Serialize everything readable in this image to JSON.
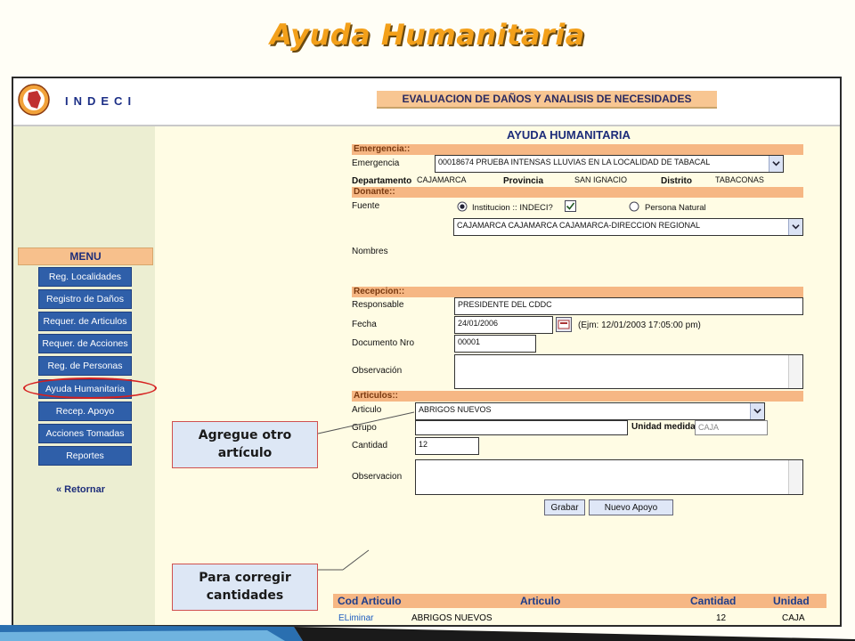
{
  "slide": {
    "title": "Ayuda Humanitaria"
  },
  "header": {
    "brand": "INDECI",
    "banner": "EVALUACION DE DAÑOS Y ANALISIS DE NECESIDADES"
  },
  "sidebar": {
    "menu_title": "MENU",
    "items": [
      {
        "label": "Reg. Localidades"
      },
      {
        "label": "Registro de Daños"
      },
      {
        "label": "Requer. de Articulos"
      },
      {
        "label": "Requer. de Acciones"
      },
      {
        "label": "Reg. de Personas"
      },
      {
        "label": "Ayuda Humanitaria"
      },
      {
        "label": "Recep. Apoyo"
      },
      {
        "label": "Acciones Tomadas"
      },
      {
        "label": "Reportes"
      }
    ],
    "back": "« Retornar"
  },
  "form": {
    "page_title": "AYUDA HUMANITARIA",
    "emergencia": {
      "section": "Emergencia::",
      "label": "Emergencia",
      "value": "00018674 PRUEBA INTENSAS LLUVIAS EN LA LOCALIDAD DE TABACAL",
      "departamento_label": "Departamento",
      "departamento": "CAJAMARCA",
      "provincia_label": "Provincia",
      "provincia": "SAN IGNACIO",
      "distrito_label": "Distrito",
      "distrito": "TABACONAS"
    },
    "donante": {
      "section": "Donante::",
      "fuente_label": "Fuente",
      "opt_institucion": "Institucion :: INDECI?",
      "opt_persona": "Persona Natural",
      "institucion_value": "CAJAMARCA CAJAMARCA CAJAMARCA-DIRECCION REGIONAL",
      "nombres_label": "Nombres"
    },
    "recepcion": {
      "section": "Recepcion::",
      "responsable_label": "Responsable",
      "responsable": "PRESIDENTE DEL CDDC",
      "fecha_label": "Fecha",
      "fecha": "24/01/2006",
      "fecha_hint": "(Ejm: 12/01/2003 17:05:00 pm)",
      "documento_label": "Documento Nro",
      "documento": "00001",
      "observacion_label": "Observación",
      "observacion": ""
    },
    "articulos": {
      "section": "Articulos::",
      "articulo_label": "Articulo",
      "articulo": "ABRIGOS NUEVOS",
      "grupo_label": "Grupo",
      "grupo": "",
      "unidad_label": "Unidad medida",
      "unidad": "CAJA",
      "cantidad_label": "Cantidad",
      "cantidad": "12",
      "observacion_label": "Observacion",
      "observacion": ""
    },
    "buttons": {
      "grabar": "Grabar",
      "nuevo": "Nuevo Apoyo"
    }
  },
  "table": {
    "headers": [
      "Cod Articulo",
      "Articulo",
      "Cantidad",
      "Unidad"
    ],
    "rows": [
      {
        "action": "ELiminar",
        "articulo": "ABRIGOS NUEVOS",
        "cantidad": "12",
        "unidad": "CAJA"
      }
    ]
  },
  "callouts": {
    "agregue": "Agregue otro artículo",
    "corregir": "Para corregir cantidades"
  },
  "colors": {
    "accent": "#f3a01a",
    "menu_button": "#2f5fa9",
    "section_header": "#f6b784",
    "highlight": "#d62020"
  }
}
